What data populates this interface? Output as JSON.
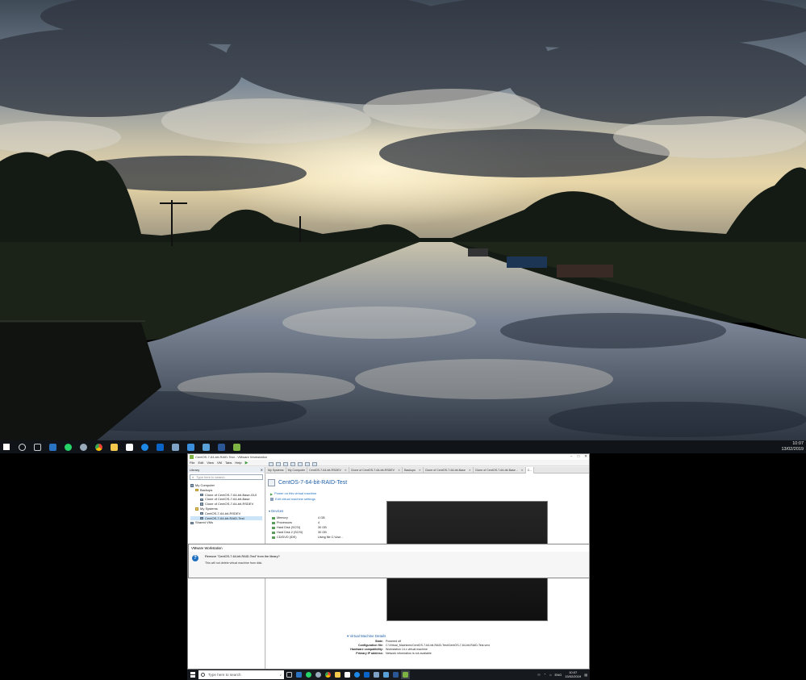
{
  "desktop_top": {
    "taskbar": {
      "icons": [
        "windows-start-icon",
        "cortana-icon",
        "task-view-icon",
        "onedrive-icon",
        "whatsapp-icon",
        "search-tool-icon",
        "chrome-icon",
        "file-explorer-icon",
        "store-icon",
        "edge-icon",
        "outlook-icon",
        "app-icon",
        "azure-icon",
        "vmware-remote-icon",
        "word-icon",
        "vmware-workstation-icon"
      ],
      "time": "10:07",
      "date": "13/02/2019"
    }
  },
  "vmware": {
    "title": "CentOS-7-64-bit-RAID-Test - VMware Workstation",
    "menu": [
      "File",
      "Edit",
      "View",
      "VM",
      "Tabs",
      "Help"
    ],
    "library": {
      "header": "Library",
      "search_placeholder": "Type here to search",
      "tree": [
        "My Computer",
        "Backups",
        "Clone of CentOS-7-64-bit-Base-GUI",
        "Clone of CentOS-7-64-bit-Base",
        "Clone of CentOS-7-64-bit-RSDEV",
        "My Systems",
        "CentOS-7-64-bit-RSDEV",
        "CentOS-7-64-bit-RAID-Test",
        "Shared VMs"
      ]
    },
    "tabs": [
      "My Systems",
      "My Computer",
      "CentOS-7-64-bit-RSDEV",
      "Clone of CentOS-7-64-bit-RSDEV",
      "Backups",
      "Clone of CentOS-7-64-bit-Base",
      "Clone of CentOS-7-64-bit-Base...",
      "C..."
    ],
    "vm_name": "CentOS-7-64-bit-RAID-Test",
    "actions": {
      "power_on": "Power on this virtual machine",
      "edit_settings": "Edit virtual machine settings"
    },
    "devices": {
      "header": "Devices",
      "items": [
        {
          "name": "Memory",
          "value": "4 GB"
        },
        {
          "name": "Processors",
          "value": "4"
        },
        {
          "name": "Hard Disk (SCSI)",
          "value": "30 GB"
        },
        {
          "name": "Hard Disk 2 (SCSI)",
          "value": "30 GB"
        },
        {
          "name": "CD/DVD (IDE)",
          "value": "Using file C:\\Use..."
        }
      ]
    },
    "details": {
      "header": "Virtual Machine Details",
      "rows": [
        {
          "label": "State:",
          "value": "Powered off"
        },
        {
          "label": "Configuration file:",
          "value": "C:\\Virtual_Machines\\CentOS-7-64-bit-RAID-Test\\CentOS-7-64-bit-RAID-Test.vmx"
        },
        {
          "label": "Hardware compatibility:",
          "value": "Workstation 14.x virtual machine"
        },
        {
          "label": "Primary IP address:",
          "value": "Network information is not available"
        }
      ]
    },
    "dialog": {
      "title": "VMware Workstation",
      "message": "Remove \"CentOS-7-64-bit-RAID-Test\" from the library?",
      "sub": "This will not delete virtual machine from disk."
    }
  },
  "desktop_bottom": {
    "taskbar": {
      "search_placeholder": "Type here to search",
      "language": "ENG",
      "time": "10:07",
      "date": "13/02/2019"
    }
  },
  "colors": {
    "taskbar": "#101418",
    "vmware_accent": "#1f5fa8",
    "link": "#1f6fc1"
  }
}
